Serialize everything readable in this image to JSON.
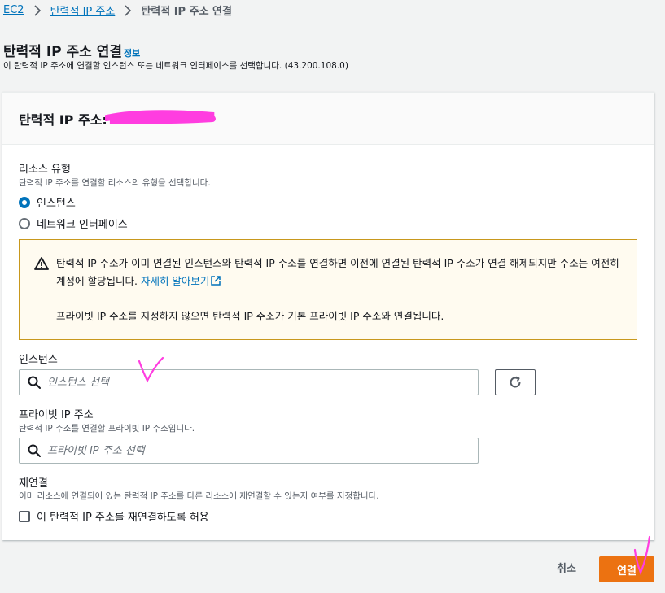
{
  "breadcrumb": {
    "items": [
      "EC2",
      "탄력적 IP 주소"
    ],
    "current": "탄력적 IP 주소 연결"
  },
  "header": {
    "title": "탄력적 IP 주소 연결",
    "info_link": "정보",
    "description": "이 탄력적 IP 주소에 연결할 인스턴스 또는 네트워크 인터페이스를 선택합니다. (43.200.108.0)"
  },
  "card": {
    "title": "탄력적 IP 주소:",
    "resource_type": {
      "label": "리소스 유형",
      "description": "탄력적 IP 주소를 연결할 리소스의 유형을 선택합니다.",
      "options": [
        "인스턴스",
        "네트워크 인터페이스"
      ],
      "selected": "인스턴스"
    },
    "alert": {
      "text_before_link": "탄력적 IP 주소가 이미 연결된 인스턴스와 탄력적 IP 주소를 연결하면 이전에 연결된 탄력적 IP 주소가 연결 해제되지만 주소는 여전히 계정에 할당됩니다.",
      "link": "자세히 알아보기",
      "text2": "프라이빗 IP 주소를 지정하지 않으면 탄력적 IP 주소가 기본 프라이빗 IP 주소와 연결됩니다."
    },
    "instance": {
      "label": "인스턴스",
      "placeholder": "인스턴스 선택"
    },
    "private_ip": {
      "label": "프라이빗 IP 주소",
      "description": "탄력적 IP 주소를 연결할 프라이빗 IP 주소입니다.",
      "placeholder": "프라이빗 IP 주소 선택"
    },
    "reassociate": {
      "label": "재연결",
      "description": "이미 리소스에 연결되어 있는 탄력적 IP 주소를 다른 리소스에 재연결할 수 있는지 여부를 지정합니다.",
      "checkbox_label": "이 탄력적 IP 주소를 재연결하도록 허용",
      "checked": false
    }
  },
  "footer": {
    "cancel": "취소",
    "connect": "연결"
  },
  "colors": {
    "link": "#0073bb",
    "primary_button": "#ec7211",
    "alert_border": "#c8981d",
    "alert_bg": "#fffbf0",
    "annotation_pink": "#ff3de0"
  }
}
